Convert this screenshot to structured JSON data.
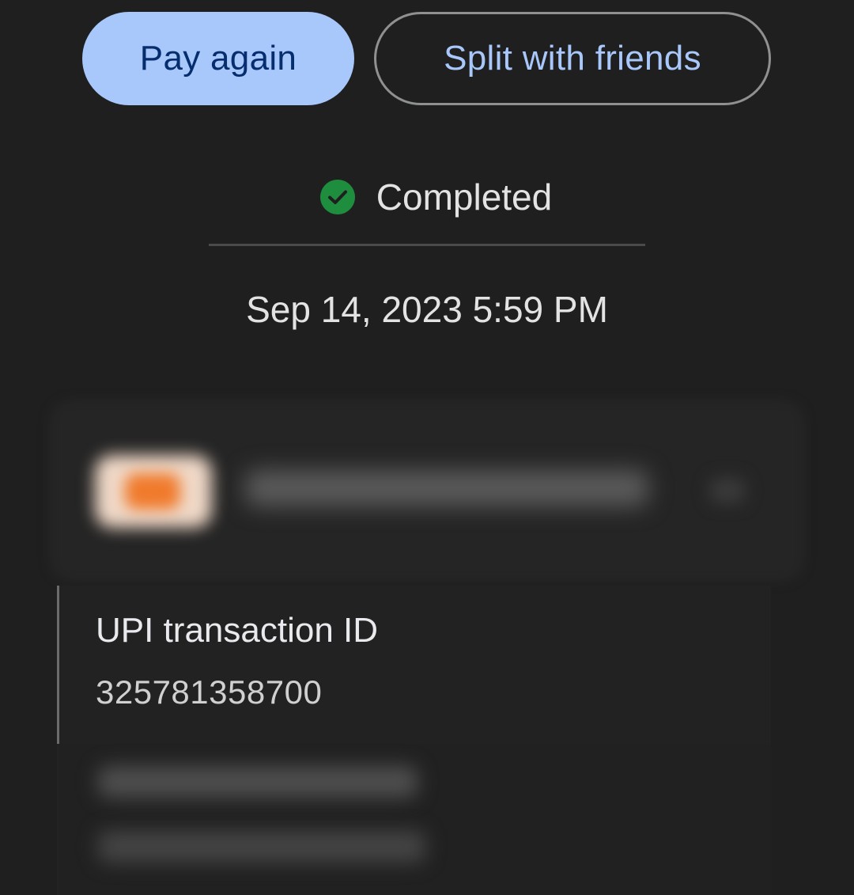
{
  "actions": {
    "pay_again_label": "Pay again",
    "split_label": "Split with friends"
  },
  "status": {
    "icon": "check-circle-icon",
    "text": "Completed",
    "color": "#1e8e3e"
  },
  "timestamp": "Sep 14, 2023 5:59 PM",
  "payment_account": {
    "logo_icon": "bank-logo",
    "chevron_icon": "chevron-down-icon"
  },
  "transaction": {
    "upi_label": "UPI transaction ID",
    "upi_value": "325781358700"
  },
  "colors": {
    "primary_button_bg": "#a8c7fa",
    "primary_button_text": "#062e6f",
    "outline_button_text": "#a8c7fa",
    "background": "#1f1f1f"
  }
}
